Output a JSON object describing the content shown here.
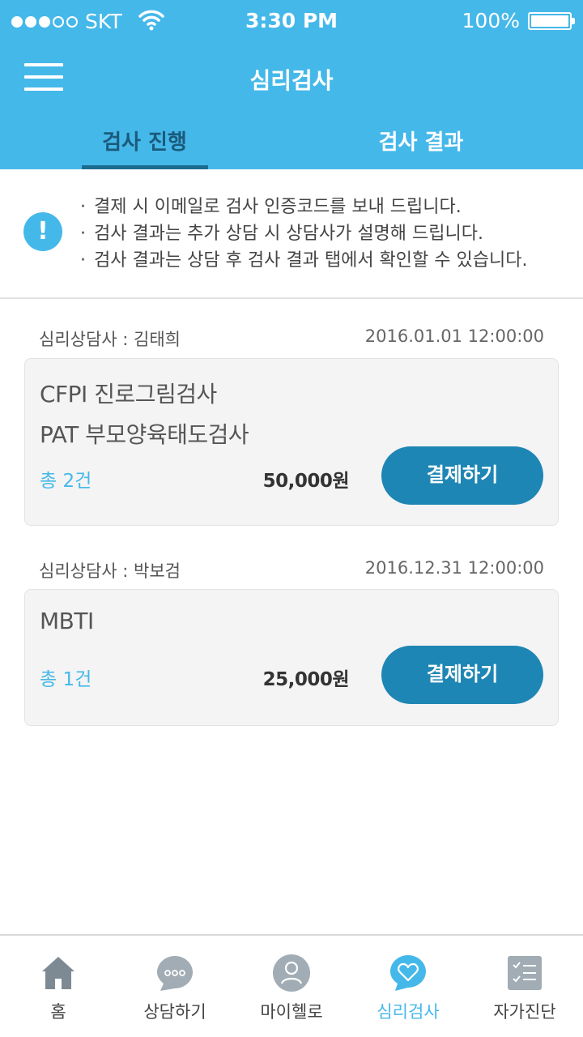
{
  "status_bar": {
    "carrier": "SKT",
    "time": "3:30 PM",
    "battery": "100%"
  },
  "header": {
    "title": "심리검사",
    "tabs": [
      {
        "label": "검사 진행",
        "active": true
      },
      {
        "label": "검사  결과",
        "active": false
      }
    ]
  },
  "notice": {
    "lines": [
      "결제 시 이메일로 검사 인증코드를 보내 드립니다.",
      "검사 결과는 추가 상담 시 상담사가 설명해 드립니다.",
      "검사 결과는 상담 후 검사 결과 탭에서 확인할 수 있습니다."
    ]
  },
  "orders": [
    {
      "counselor": "심리상담사 : 김태희",
      "date": "2016.01.01  12:00:00",
      "tests": [
        "CFPI 진로그림검사",
        "PAT 부모양육태도검사"
      ],
      "count": "총  2건",
      "price": "50,000원",
      "pay_label": "결제하기"
    },
    {
      "counselor": "심리상담사 : 박보검",
      "date": "2016.12.31  12:00:00",
      "tests": [
        "MBTI"
      ],
      "count": "총  1건",
      "price": "25,000원",
      "pay_label": "결제하기"
    }
  ],
  "bottom_nav": [
    {
      "label": "홈",
      "icon": "home-icon",
      "active": false
    },
    {
      "label": "상담하기",
      "icon": "chat-bubble-icon",
      "active": false
    },
    {
      "label": "마이헬로",
      "icon": "person-icon",
      "active": false
    },
    {
      "label": "심리검사",
      "icon": "heart-bubble-icon",
      "active": true
    },
    {
      "label": "자가진단",
      "icon": "checklist-icon",
      "active": false
    }
  ],
  "colors": {
    "primary": "#45b8ea",
    "button": "#1e86b4",
    "active_tab_text": "#1b5a7b"
  }
}
